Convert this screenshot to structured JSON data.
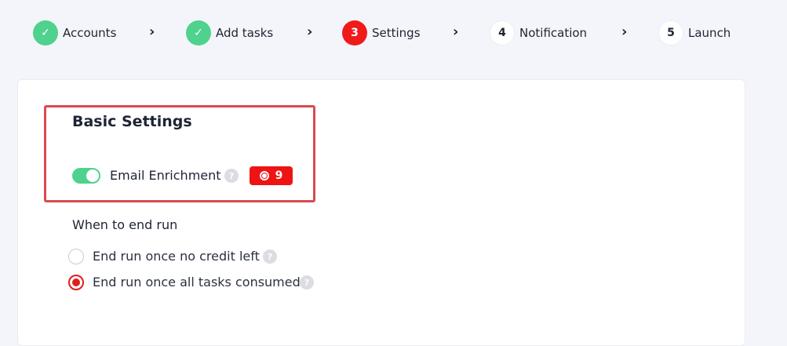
{
  "stepper": {
    "steps": [
      {
        "marker": "✓",
        "label": "Accounts",
        "state": "done"
      },
      {
        "marker": "✓",
        "label": "Add tasks",
        "state": "done"
      },
      {
        "marker": "3",
        "label": "Settings",
        "state": "active"
      },
      {
        "marker": "4",
        "label": "Notification",
        "state": "pending"
      },
      {
        "marker": "5",
        "label": "Launch",
        "state": "pending"
      }
    ],
    "separator": "›"
  },
  "basic_settings": {
    "title": "Basic Settings",
    "email_enrichment": {
      "label": "Email Enrichment",
      "enabled": true,
      "help": "?",
      "credit_cost": "9",
      "credit_icon": "coin-icon"
    }
  },
  "end_run": {
    "heading": "When to end run",
    "options": [
      {
        "label": "End run once no credit left",
        "selected": false,
        "help": "?"
      },
      {
        "label": "End run once all tasks consumed",
        "selected": true,
        "help": "?"
      }
    ]
  },
  "colors": {
    "done": "#4fd28d",
    "active": "#f01a1a",
    "highlight": "#d94a4f",
    "radio_selected": "#e11d1d"
  }
}
